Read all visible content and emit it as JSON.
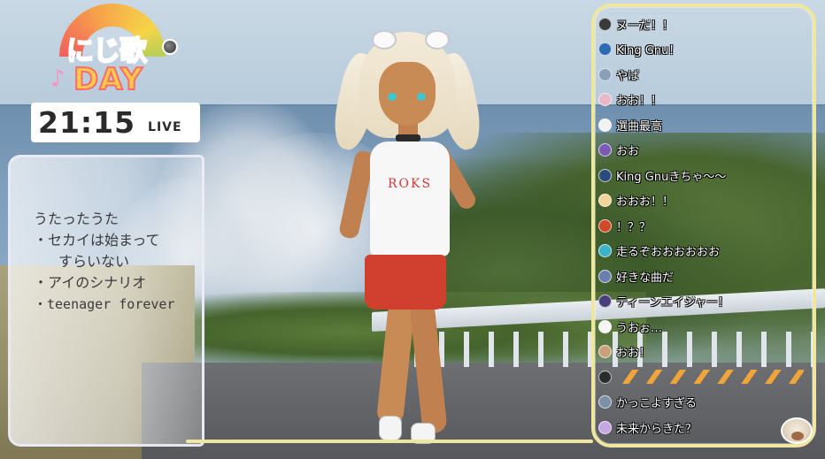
{
  "logo": {
    "title": "にじ歌",
    "day": "DAY",
    "note": "♪"
  },
  "clock": {
    "time": "21:15",
    "live": "LIVE"
  },
  "setlist": {
    "lines": [
      "うたったうた",
      "・セカイは始まって",
      "すらいない",
      "・アイのシナリオ",
      "・teenager forever"
    ]
  },
  "character": {
    "shirt_text": "ROKS"
  },
  "chat": {
    "messages": [
      {
        "text": "ヌーだ！！",
        "avatar_color": "#3a3a3a"
      },
      {
        "text": "King Gnu！",
        "avatar_color": "#2c6bb3"
      },
      {
        "text": "やば",
        "avatar_color": "#8aa0b8"
      },
      {
        "text": "おお！！",
        "avatar_color": "#e8b7c8"
      },
      {
        "text": "選曲最高",
        "avatar_color": "#f2f2f2"
      },
      {
        "text": "おお",
        "avatar_color": "#7b5bb5"
      },
      {
        "text": "King Gnuきちゃ〜〜",
        "avatar_color": "#2a4a7a"
      },
      {
        "text": "おおお！！",
        "avatar_color": "#f0d49a"
      },
      {
        "text": "！？？",
        "avatar_color": "#d04a2a"
      },
      {
        "text": "走るぞおおおおおお",
        "avatar_color": "#3bb3c9"
      },
      {
        "text": "好きな曲だ",
        "avatar_color": "#6a7fb0"
      },
      {
        "text": "ティーンエイジャー！",
        "avatar_color": "#4a3f7a"
      },
      {
        "text": "うおぉ…",
        "avatar_color": "#f5f5f5"
      },
      {
        "text": "おお！",
        "avatar_color": "#c9a07a"
      },
      {
        "text": "",
        "avatar_color": "#2b2b2b",
        "stripes": true
      },
      {
        "text": "かっこよすぎる",
        "avatar_color": "#7a8fa8"
      },
      {
        "text": "未来からきた？",
        "avatar_color": "#c8a6e6"
      }
    ]
  }
}
